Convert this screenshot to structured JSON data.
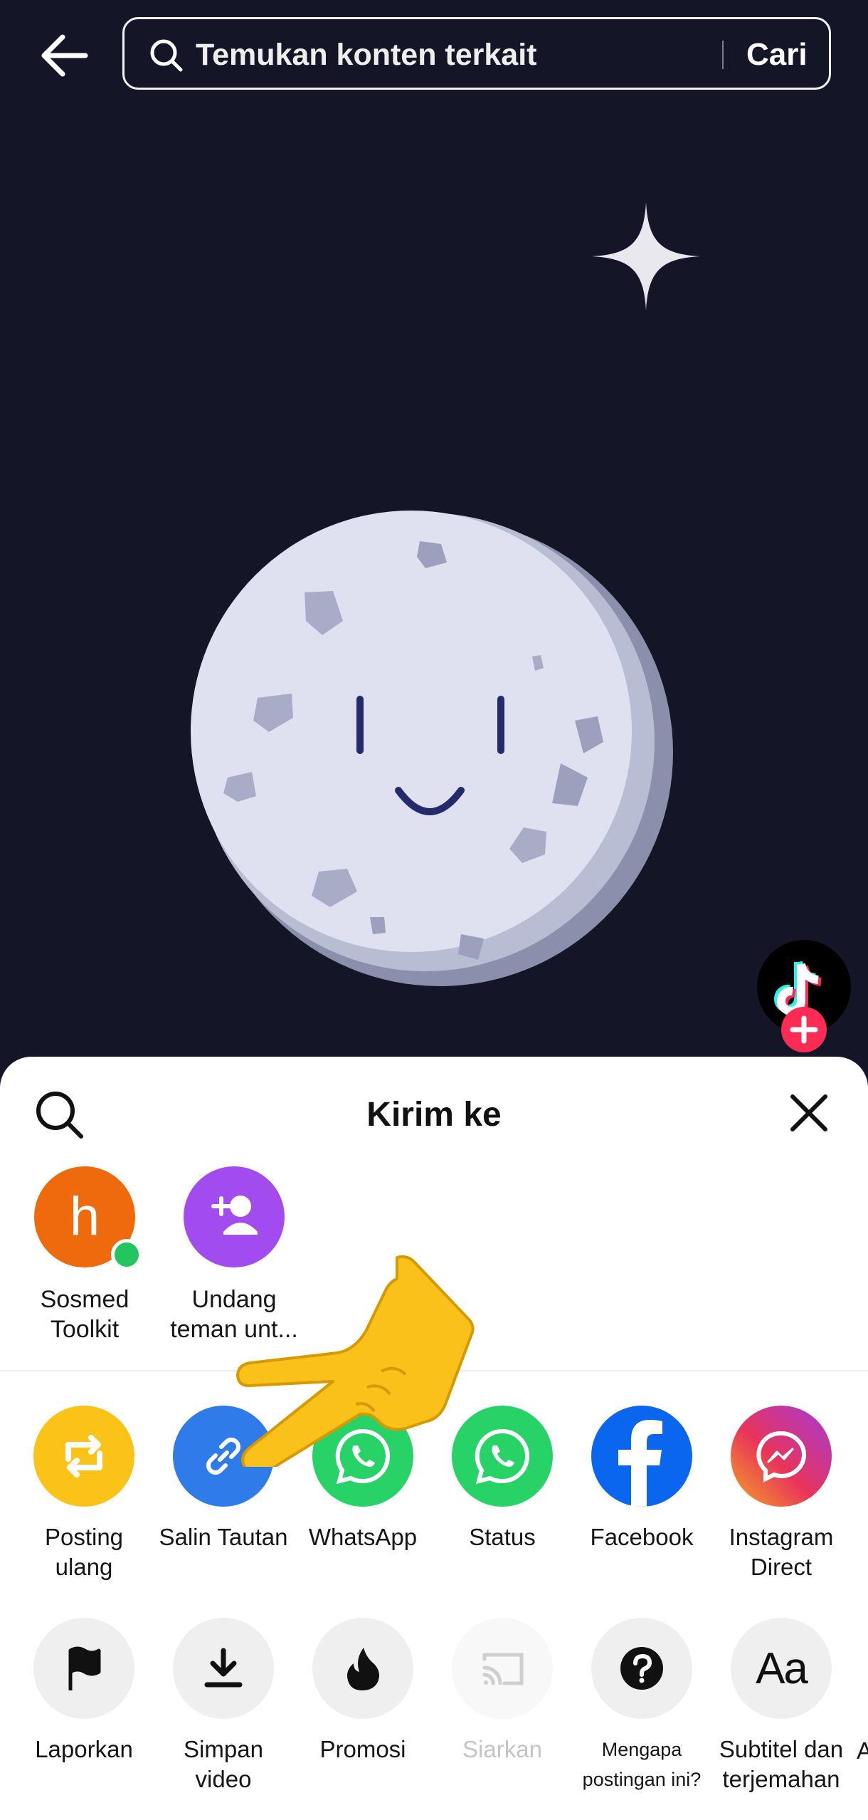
{
  "search": {
    "placeholder": "Temukan konten terkait",
    "button": "Cari"
  },
  "sheet": {
    "title": "Kirim ke",
    "contacts": [
      {
        "initial": "h",
        "label_line1": "Sosmed",
        "label_line2": "Toolkit",
        "color": "#ee6a0c",
        "online": true
      },
      {
        "label_line1": "Undang",
        "label_line2": "teman unt...",
        "color": "#a24cf0"
      }
    ],
    "share": [
      {
        "label_line1": "Posting",
        "label_line2": "ulang",
        "color": "#fbc217",
        "icon": "repost-icon"
      },
      {
        "label_line1": "Salin Tautan",
        "label_line2": "",
        "color": "#2f7bea",
        "icon": "link-icon"
      },
      {
        "label_line1": "WhatsApp",
        "label_line2": "",
        "color": "#27d366",
        "icon": "whatsapp-icon"
      },
      {
        "label_line1": "Status",
        "label_line2": "",
        "color": "#27d366",
        "icon": "whatsapp-status-icon"
      },
      {
        "label_line1": "Facebook",
        "label_line2": "",
        "color": "#0a66ee",
        "icon": "facebook-icon"
      },
      {
        "label_line1": "Instagram",
        "label_line2": "Direct",
        "color": "#c8379b",
        "icon": "messenger-icon"
      }
    ],
    "actions": [
      {
        "label_line1": "Laporkan",
        "label_line2": "",
        "icon": "flag-icon"
      },
      {
        "label_line1": "Simpan",
        "label_line2": "video",
        "icon": "download-icon"
      },
      {
        "label_line1": "Promosi",
        "label_line2": "",
        "icon": "flame-icon"
      },
      {
        "label_line1": "Siarkan",
        "label_line2": "",
        "icon": "cast-icon"
      },
      {
        "label_line1": "Mengapa",
        "label_line2": "postingan ini?",
        "icon": "question-icon"
      },
      {
        "label_line1": "Subtitel dan",
        "label_line2": "terjemahan",
        "icon": "subtitle-icon"
      }
    ],
    "edge_letter": "A"
  },
  "colors": {
    "background": "#141627",
    "tiktok_red": "#fe2c55",
    "tiktok_cyan": "#25f4ee"
  }
}
